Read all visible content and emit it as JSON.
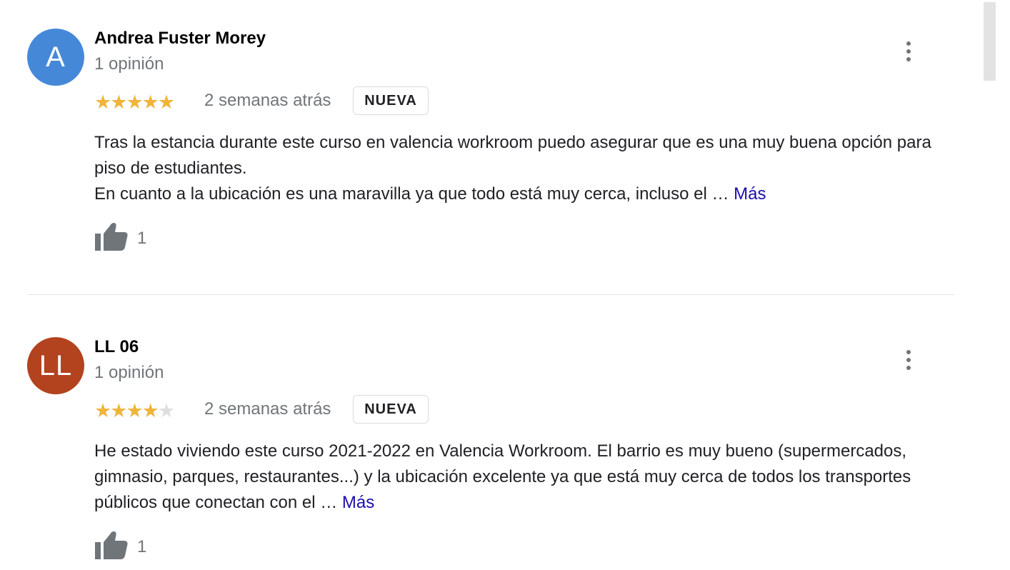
{
  "reviews": [
    {
      "author": "Andrea Fuster Morey",
      "avatar_letter": "A",
      "avatar_color": "#4688d8",
      "review_count": "1 opinión",
      "rating": 5,
      "rating_max": 5,
      "date": "2 semanas atrás",
      "badge": "NUEVA",
      "text_line1": "Tras la estancia durante este curso en valencia workroom puedo asegurar que es una muy buena opción para piso de estudiantes.",
      "text_line2": "En cuanto a la ubicación es una maravilla ya que todo está muy cerca, incluso el … ",
      "more_label": "Más",
      "likes": "1",
      "menu_icon": "more-vert-icon",
      "like_icon": "thumb-up-icon"
    },
    {
      "author": "LL 06",
      "avatar_letter": "LL",
      "avatar_color": "#b3431f",
      "review_count": "1 opinión",
      "rating": 4,
      "rating_max": 5,
      "date": "2 semanas atrás",
      "badge": "NUEVA",
      "text_line1": "He estado viviendo este curso 2021-2022 en Valencia Workroom. El barrio es muy bueno (supermercados, gimnasio, parques, restaurantes...) y la ubicación excelente ya que está muy cerca de todos los transportes públicos que conectan con el … ",
      "text_line2": "",
      "more_label": "Más",
      "likes": "1",
      "menu_icon": "more-vert-icon",
      "like_icon": "thumb-up-icon"
    }
  ],
  "colors": {
    "star_filled": "#f0b43c",
    "star_empty": "#dddddd",
    "link": "#1a0dab",
    "secondary_text": "#70757a"
  }
}
